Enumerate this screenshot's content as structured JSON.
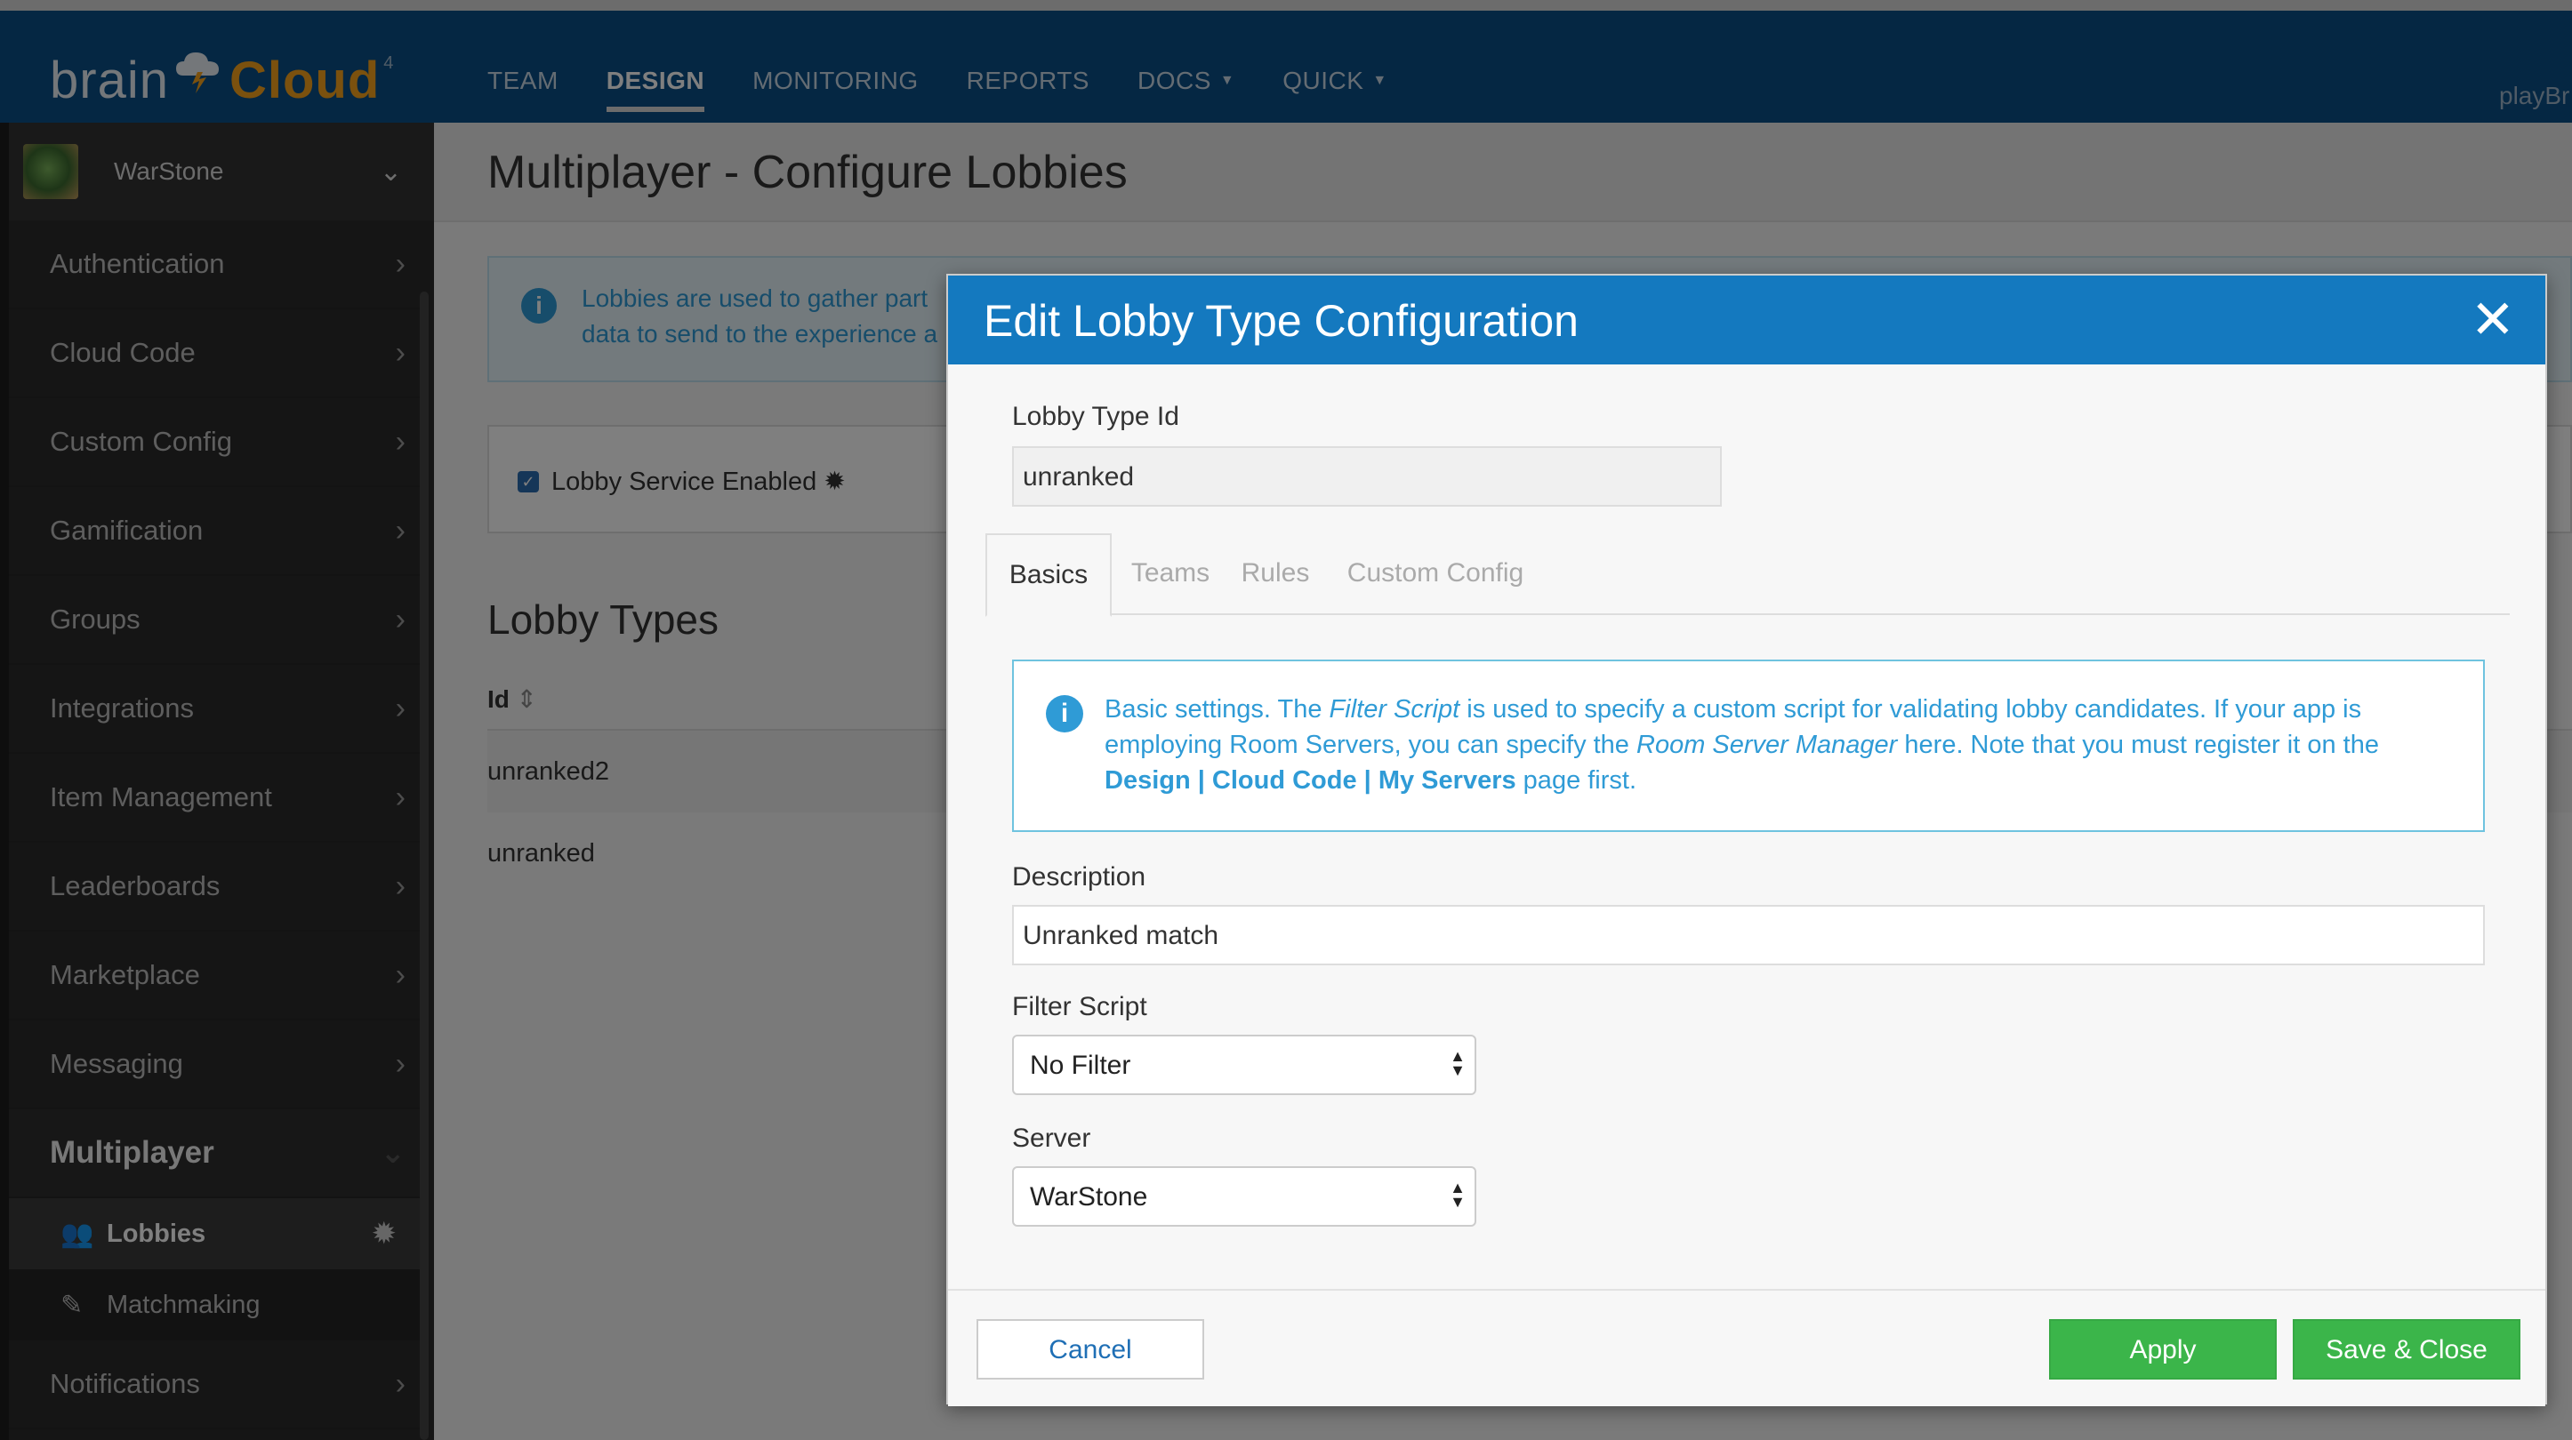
{
  "brand": {
    "word1": "brain",
    "word2": "Cloud",
    "mark": "4"
  },
  "topnav": {
    "items": [
      "TEAM",
      "DESIGN",
      "MONITORING",
      "REPORTS",
      "DOCS",
      "QUICK"
    ],
    "user": "playBr"
  },
  "sidebar": {
    "app_name": "WarStone",
    "items": [
      "Authentication",
      "Cloud Code",
      "Custom Config",
      "Gamification",
      "Groups",
      "Integrations",
      "Item Management",
      "Leaderboards",
      "Marketplace",
      "Messaging"
    ],
    "open_section": "Multiplayer",
    "sub_items": [
      "Lobbies",
      "Matchmaking"
    ],
    "after_items": [
      "Notifications"
    ]
  },
  "page": {
    "title": "Multiplayer - Configure Lobbies",
    "info": "Lobbies are used to gather part",
    "info_line2": "data to send to the experience a",
    "service_label": "Lobby Service Enabled",
    "lobby_types_title": "Lobby Types",
    "table_header_id": "Id",
    "rows": [
      "unranked2",
      "unranked"
    ]
  },
  "modal": {
    "title": "Edit Lobby Type Configuration",
    "lobby_type_id_label": "Lobby Type Id",
    "lobby_type_id_value": "unranked",
    "tabs": [
      "Basics",
      "Teams",
      "Rules",
      "Custom Config"
    ],
    "info": {
      "p1": "Basic settings. The ",
      "em1": "Filter Script",
      "p2": " is used to specify a custom script for validating lobby candidates. If your app is employing Room Servers, you can specify the ",
      "em2": "Room Server Manager",
      "p3": " here. Note that you must register it on the ",
      "b1": "Design | Cloud Code | My Servers",
      "p4": " page first."
    },
    "description_label": "Description",
    "description_value": "Unranked match",
    "filter_label": "Filter Script",
    "filter_value": "No Filter",
    "server_label": "Server",
    "server_value": "WarStone",
    "cancel": "Cancel",
    "apply": "Apply",
    "save_close": "Save & Close"
  },
  "colors": {
    "nav_bg": "#0b4f86",
    "modal_header": "#1479bf",
    "accent_green": "#3bb54a",
    "info_blue": "#2f9bd6"
  },
  "icons": [
    "cloud-logo-icon",
    "chevron-down-icon",
    "chevron-right-icon",
    "info-icon",
    "close-icon",
    "users-icon",
    "pencil-icon",
    "gear-icon",
    "sort-icon",
    "select-arrows-icon"
  ]
}
